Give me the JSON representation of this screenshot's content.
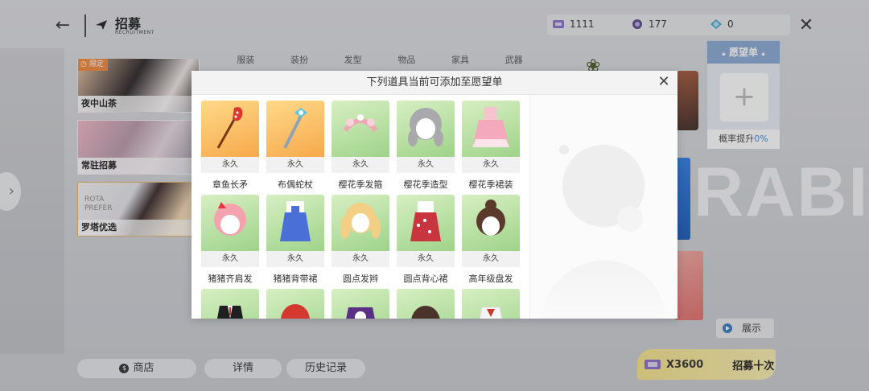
{
  "header": {
    "back_icon": "arrow-left-icon",
    "title": "招募",
    "subtitle": "RECRUITMENT"
  },
  "currencies": [
    {
      "icon": "ticket-icon",
      "value": "1111"
    },
    {
      "icon": "orb-icon",
      "value": "177"
    },
    {
      "icon": "diamond-icon",
      "value": "0"
    }
  ],
  "category_tabs": [
    "服装",
    "装扮",
    "发型",
    "物品",
    "家具",
    "武器"
  ],
  "banners": [
    {
      "name": "夜中山茶",
      "tag": "限定"
    },
    {
      "name": "常驻招募",
      "tag": ""
    },
    {
      "name": "罗塔优选",
      "tag": "",
      "overlay_text": "ROTA\nPREFER"
    }
  ],
  "background_text": "RABI",
  "wishlist": {
    "title": "愿望单",
    "footer_label": "概率提升",
    "footer_value": "0%"
  },
  "show_button": "展示",
  "bottom_buttons": {
    "shop": "商店",
    "details": "详情",
    "history": "历史记录"
  },
  "recruit_ten": {
    "cost": "X3600",
    "label": "招募十次"
  },
  "modal": {
    "title": "下列道具当前可添加至愿望单",
    "items": [
      {
        "name": "章鱼长矛",
        "duration": "永久",
        "bg": "orange",
        "art": "spear"
      },
      {
        "name": "布偶蛇杖",
        "duration": "永久",
        "bg": "orange",
        "art": "staff"
      },
      {
        "name": "樱花季发箍",
        "duration": "永久",
        "bg": "green",
        "art": "headband"
      },
      {
        "name": "樱花季造型",
        "duration": "永久",
        "bg": "green",
        "art": "hair-grey"
      },
      {
        "name": "樱花季裙装",
        "duration": "永久",
        "bg": "green",
        "art": "dress-pink"
      },
      {
        "name": "猪猪齐肩发",
        "duration": "永久",
        "bg": "green",
        "art": "hair-pink"
      },
      {
        "name": "猪猪背带裙",
        "duration": "永久",
        "bg": "green",
        "art": "dress-blue"
      },
      {
        "name": "圆点发辫",
        "duration": "永久",
        "bg": "green",
        "art": "hair-blonde"
      },
      {
        "name": "圆点背心裙",
        "duration": "永久",
        "bg": "green",
        "art": "dress-red"
      },
      {
        "name": "高年级盘发",
        "duration": "永久",
        "bg": "green",
        "art": "hair-bun"
      },
      {
        "name": "",
        "duration": "",
        "bg": "green",
        "art": "coat-black"
      },
      {
        "name": "",
        "duration": "",
        "bg": "green",
        "art": "hair-red"
      },
      {
        "name": "",
        "duration": "",
        "bg": "green",
        "art": "shirt-purple"
      },
      {
        "name": "",
        "duration": "",
        "bg": "green",
        "art": "hair-brown"
      },
      {
        "name": "",
        "duration": "",
        "bg": "green",
        "art": "outfit-white"
      }
    ]
  },
  "colors": {
    "wish_header": "#8aa8d2",
    "limited_tag": "#f08a3c",
    "accent_blue": "#3a8ee0",
    "recruit_button": "#f6e38a"
  }
}
